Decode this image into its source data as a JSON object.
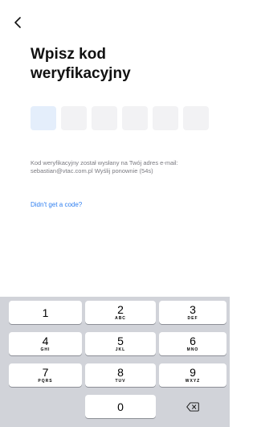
{
  "header": {
    "title_lines": [
      "Wpisz kod",
      "weryfikacyjny"
    ]
  },
  "code": {
    "length": 6,
    "active_index": 0
  },
  "info_text": "Kod weryfikacyjny został wysłany na Twój adres e-mail: sebastian@vtac.com.pl  Wyślij ponownie (54s)",
  "help_link": "Didn't get a code?",
  "keypad": {
    "keys": [
      {
        "digit": "1",
        "letters": ""
      },
      {
        "digit": "2",
        "letters": "ABC"
      },
      {
        "digit": "3",
        "letters": "DEF"
      },
      {
        "digit": "4",
        "letters": "GHI"
      },
      {
        "digit": "5",
        "letters": "JKL"
      },
      {
        "digit": "6",
        "letters": "MNO"
      },
      {
        "digit": "7",
        "letters": "PQRS"
      },
      {
        "digit": "8",
        "letters": "TUV"
      },
      {
        "digit": "9",
        "letters": "WXYZ"
      },
      {
        "digit": "0",
        "letters": ""
      }
    ]
  },
  "colors": {
    "accent": "#2f7ff0",
    "keyboard_bg": "#d1d3d9",
    "code_box": "#f2f2f4",
    "code_box_active": "#e4eefb"
  }
}
